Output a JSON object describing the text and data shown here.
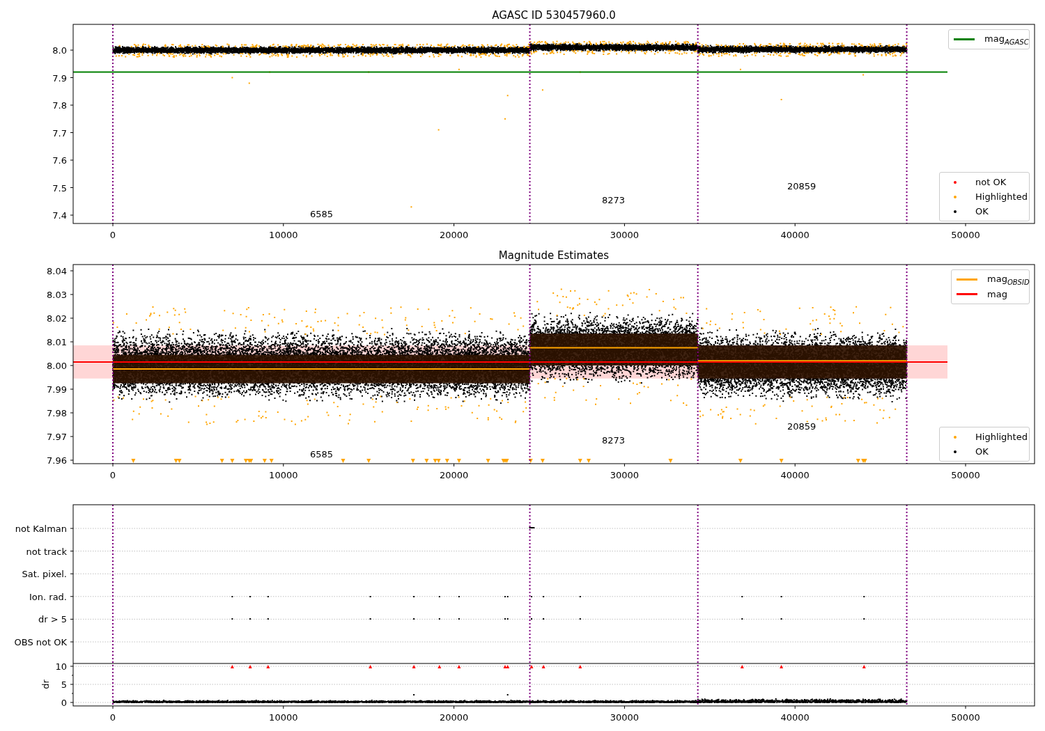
{
  "figure": {
    "panels": [
      {
        "kind": "magnitude",
        "title": "AGASC ID 530457960.0",
        "y_ticks": [
          "8.0",
          "7.9",
          "7.8",
          "7.7",
          "7.6",
          "7.5",
          "7.4"
        ],
        "x_ticks": [
          "0",
          "10000",
          "20000",
          "30000",
          "40000",
          "50000"
        ],
        "legends": [
          [
            {
              "kind": "line",
              "label": "mag$_{AGASC}$",
              "color": "#008000"
            }
          ],
          [
            {
              "kind": "marker",
              "label": "not OK",
              "color": "#ff0000"
            },
            {
              "kind": "marker",
              "label": "Highlighted",
              "color": "#ffa500"
            },
            {
              "kind": "marker",
              "label": "OK",
              "color": "#000000"
            }
          ]
        ],
        "annotations": [
          "6585",
          "8273",
          "20859"
        ]
      },
      {
        "kind": "estimates",
        "title": "Magnitude Estimates",
        "y_ticks": [
          "8.04",
          "8.03",
          "8.02",
          "8.01",
          "8.00",
          "7.99",
          "7.98",
          "7.97",
          "7.96"
        ],
        "x_ticks": [
          "0",
          "10000",
          "20000",
          "30000",
          "40000",
          "50000"
        ],
        "legends": [
          [
            {
              "kind": "line",
              "label": "mag$_{OBSID}$",
              "color": "#ffa500"
            },
            {
              "kind": "line",
              "label": "mag",
              "color": "#ff0000"
            }
          ],
          [
            {
              "kind": "marker",
              "label": "Highlighted",
              "color": "#ffa500"
            },
            {
              "kind": "marker",
              "label": "OK",
              "color": "#000000"
            }
          ]
        ],
        "annotations": [
          "6585",
          "8273",
          "20859"
        ]
      },
      {
        "kind": "flags",
        "flag_labels": [
          "not Kalman",
          "not track",
          "Sat. pixel.",
          "Ion. rad.",
          "dr > 5",
          "OBS not OK"
        ],
        "dr_ticks": [
          "10",
          "5",
          "0"
        ],
        "ylabel": "dr",
        "x_ticks": [
          "0",
          "10000",
          "20000",
          "30000",
          "40000",
          "50000"
        ]
      }
    ]
  }
}
